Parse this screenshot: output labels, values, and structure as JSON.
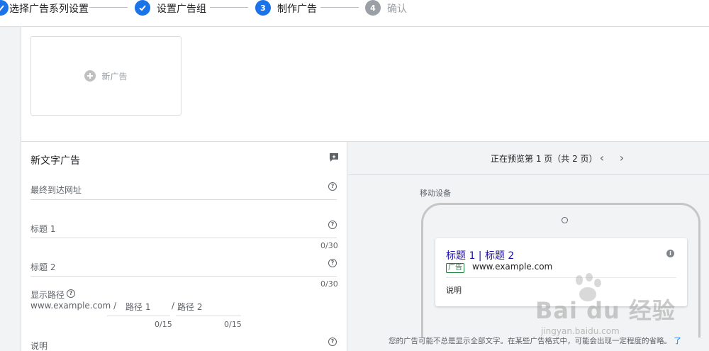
{
  "stepper": {
    "steps": [
      {
        "label": "选择广告系列设置",
        "state": "done",
        "number": ""
      },
      {
        "label": "设置广告组",
        "state": "done",
        "number": ""
      },
      {
        "label": "制作广告",
        "state": "active",
        "number": "3"
      },
      {
        "label": "确认",
        "state": "pending",
        "number": "4"
      }
    ]
  },
  "top_panel": {
    "new_ad_label": "新广告"
  },
  "form": {
    "title": "新文字广告",
    "final_url_label": "最终到达网址",
    "headline1_label": "标题 1",
    "headline1_counter": "0/30",
    "headline2_label": "标题 2",
    "headline2_counter": "0/30",
    "display_path_label": "显示路径",
    "path_base": "www.example.com /",
    "path1_label": "路径 1",
    "path1_counter": "0/15",
    "path_sep": "/",
    "path2_label": "路径 2",
    "path2_counter": "0/15",
    "description_label": "说明"
  },
  "preview": {
    "status": "正在预览第 1 页（共 2 页）",
    "device_label": "移动设备",
    "ad": {
      "headline": "标题 1 | 标题 2",
      "badge": "广告",
      "url": "www.example.com",
      "description": "说明"
    },
    "note": "您的广告可能不总是显示全部文字。在某些广告格式中，可能会出现一定程度的省略。",
    "learn_more": "了"
  },
  "watermark": {
    "main": "Bai du 经验",
    "sub": "jingyan.baidu.com"
  },
  "colors": {
    "accent": "#1a73e8",
    "pending": "#9aa0a6",
    "ad_link": "#1a0dab",
    "ad_badge": "#188038"
  }
}
